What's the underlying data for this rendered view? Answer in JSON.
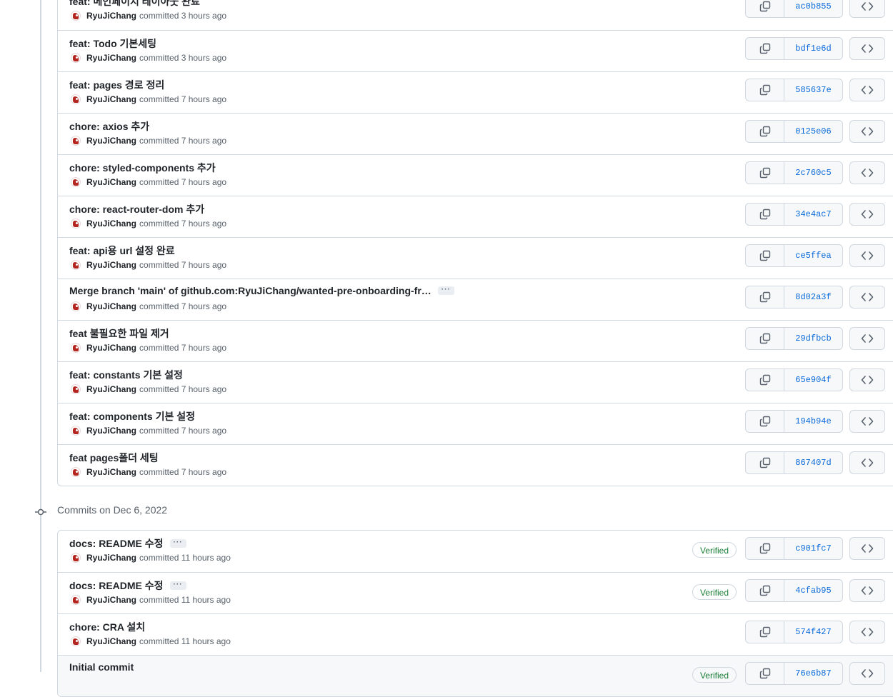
{
  "groups": [
    {
      "commits": [
        {
          "title": "feat: 메인페이지 레이아웃 완료",
          "author": "RyuJiChang",
          "time": "committed 3 hours ago",
          "sha": "ac0b855",
          "verified": false,
          "ellipsis": false
        },
        {
          "title": "feat: Todo 기본세팅",
          "author": "RyuJiChang",
          "time": "committed 3 hours ago",
          "sha": "bdf1e6d",
          "verified": false,
          "ellipsis": false
        },
        {
          "title": "feat: pages 경로 정리",
          "author": "RyuJiChang",
          "time": "committed 7 hours ago",
          "sha": "585637e",
          "verified": false,
          "ellipsis": false
        },
        {
          "title": "chore: axios 추가",
          "author": "RyuJiChang",
          "time": "committed 7 hours ago",
          "sha": "0125e06",
          "verified": false,
          "ellipsis": false
        },
        {
          "title": "chore: styled-components 추가",
          "author": "RyuJiChang",
          "time": "committed 7 hours ago",
          "sha": "2c760c5",
          "verified": false,
          "ellipsis": false
        },
        {
          "title": "chore: react-router-dom 추가",
          "author": "RyuJiChang",
          "time": "committed 7 hours ago",
          "sha": "34e4ac7",
          "verified": false,
          "ellipsis": false
        },
        {
          "title": "feat: api용 url 설정 완료",
          "author": "RyuJiChang",
          "time": "committed 7 hours ago",
          "sha": "ce5ffea",
          "verified": false,
          "ellipsis": false
        },
        {
          "title": "Merge branch 'main' of github.com:RyuJiChang/wanted-pre-onboarding-fr…",
          "author": "RyuJiChang",
          "time": "committed 7 hours ago",
          "sha": "8d02a3f",
          "verified": false,
          "ellipsis": true
        },
        {
          "title": "feat 불필요한 파일 제거",
          "author": "RyuJiChang",
          "time": "committed 7 hours ago",
          "sha": "29dfbcb",
          "verified": false,
          "ellipsis": false
        },
        {
          "title": "feat: constants 기본 설정",
          "author": "RyuJiChang",
          "time": "committed 7 hours ago",
          "sha": "65e904f",
          "verified": false,
          "ellipsis": false
        },
        {
          "title": "feat: components 기본 설정",
          "author": "RyuJiChang",
          "time": "committed 7 hours ago",
          "sha": "194b94e",
          "verified": false,
          "ellipsis": false
        },
        {
          "title": "feat pages폴더 세팅",
          "author": "RyuJiChang",
          "time": "committed 7 hours ago",
          "sha": "867407d",
          "verified": false,
          "ellipsis": false
        }
      ]
    },
    {
      "date_label": "Commits on Dec 6, 2022",
      "commits": [
        {
          "title": "docs: README 수정",
          "author": "RyuJiChang",
          "time": "committed 11 hours ago",
          "sha": "c901fc7",
          "verified": true,
          "ellipsis": true
        },
        {
          "title": "docs: README 수정",
          "author": "RyuJiChang",
          "time": "committed 11 hours ago",
          "sha": "4cfab95",
          "verified": true,
          "ellipsis": true
        },
        {
          "title": "chore: CRA 설치",
          "author": "RyuJiChang",
          "time": "committed 11 hours ago",
          "sha": "574f427",
          "verified": false,
          "ellipsis": false
        },
        {
          "title": "Initial commit",
          "author": "",
          "time": "",
          "sha": "76e6b87",
          "verified": true,
          "ellipsis": false
        }
      ]
    }
  ],
  "verified_label": "Verified",
  "ellipsis_label": "···",
  "colors": {
    "sha": "#0969da",
    "verified": "#1a7f37",
    "border": "#d0d7de"
  },
  "icons": {
    "copy": "copy-icon",
    "browse": "code-icon",
    "commit_node": "git-commit-icon"
  }
}
